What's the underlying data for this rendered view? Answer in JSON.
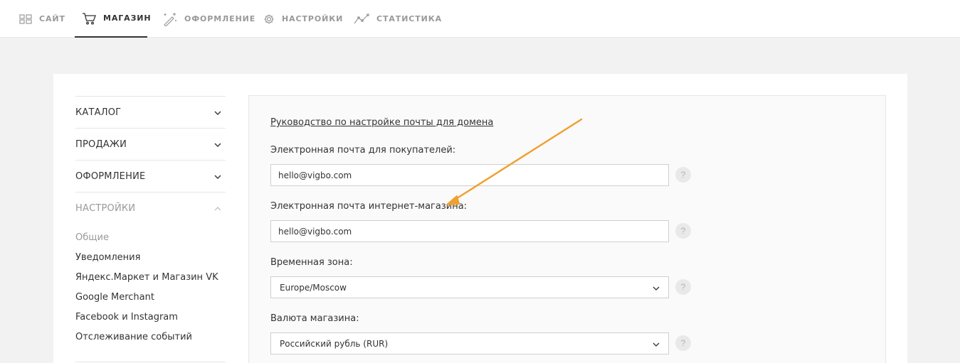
{
  "topnav": {
    "items": [
      {
        "label": "САЙТ",
        "icon": "grid-icon"
      },
      {
        "label": "МАГАЗИН",
        "icon": "cart-icon",
        "active": true
      },
      {
        "label": "ОФОРМЛЕНИЕ",
        "icon": "magic-wand-icon"
      },
      {
        "label": "НАСТРОЙКИ",
        "icon": "gear-icon"
      },
      {
        "label": "СТАТИСТИКА",
        "icon": "line-chart-icon"
      }
    ]
  },
  "sidebar": {
    "sections": [
      {
        "label": "КАТАЛОГ",
        "expanded": false
      },
      {
        "label": "ПРОДАЖИ",
        "expanded": false
      },
      {
        "label": "ОФОРМЛЕНИЕ",
        "expanded": false
      },
      {
        "label": "НАСТРОЙКИ",
        "expanded": true
      }
    ],
    "settings_items": [
      {
        "label": "Общие",
        "selected": true
      },
      {
        "label": "Уведомления"
      },
      {
        "label": "Яндекс.Маркет и Магазин VK"
      },
      {
        "label": "Google Merchant"
      },
      {
        "label": "Facebook и Instagram"
      },
      {
        "label": "Отслеживание событий"
      }
    ]
  },
  "form": {
    "guide_link": "Руководство по настройке почты для домена",
    "customer_email": {
      "label": "Электронная почта для покупателей:",
      "value": "hello@vigbo.com"
    },
    "shop_email": {
      "label": "Электронная почта интернет-магазина:",
      "value": "hello@vigbo.com"
    },
    "timezone": {
      "label": "Временная зона:",
      "value": "Europe/Moscow"
    },
    "currency": {
      "label": "Валюта магазина:",
      "value": "Российский рубль (RUR)"
    },
    "help_symbol": "?"
  },
  "colors": {
    "accent_arrow": "#f0a030",
    "text": "#333333",
    "muted": "#999999"
  }
}
